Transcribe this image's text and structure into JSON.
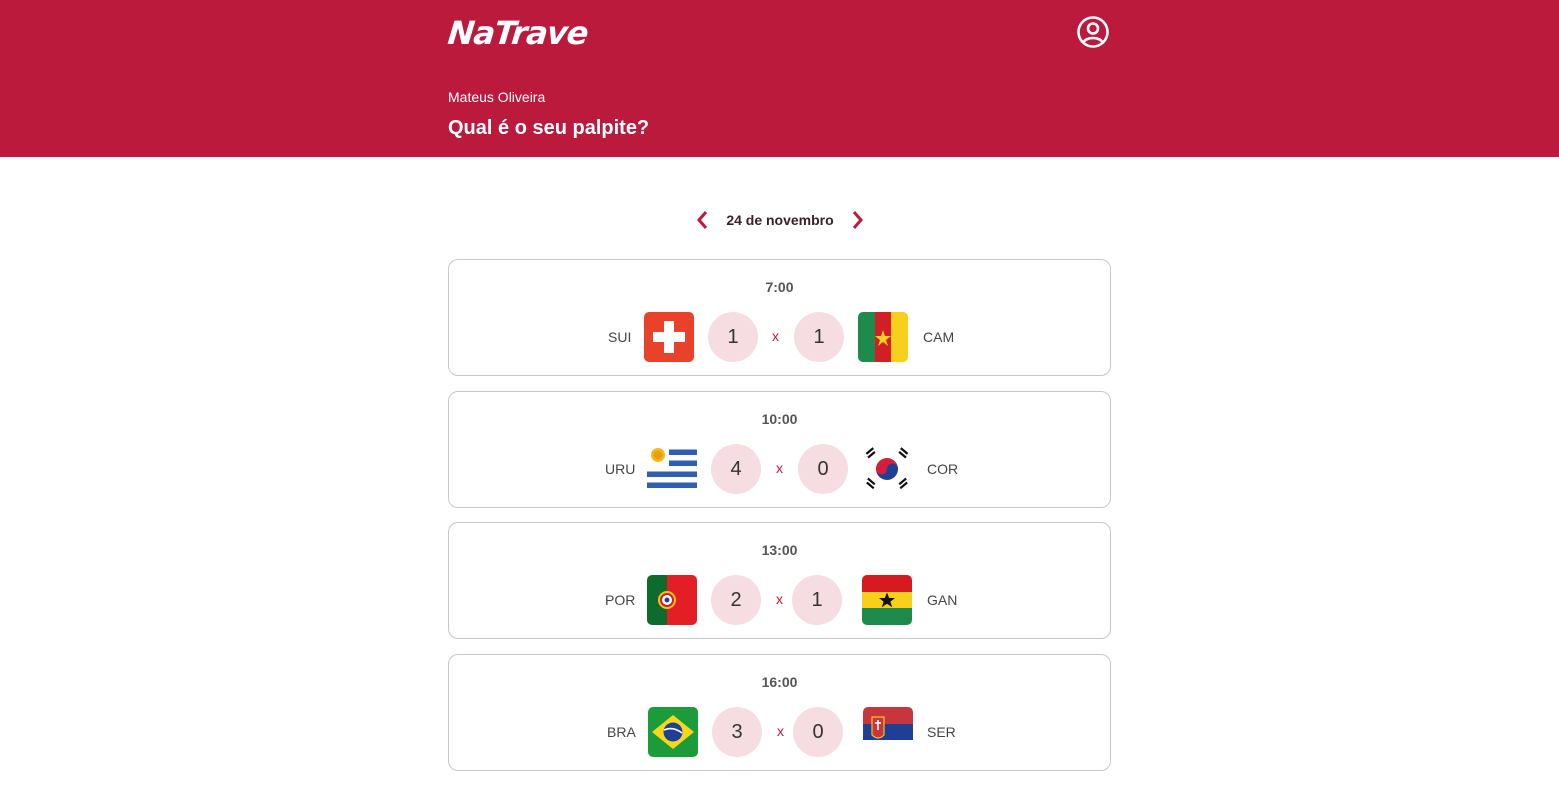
{
  "app": {
    "logo": "NaTrave"
  },
  "header": {
    "user_name": "Mateus Oliveira",
    "headline": "Qual é o seu palpite?"
  },
  "date_nav": {
    "label": "24 de novembro",
    "prev_icon": "chevron-left-icon",
    "next_icon": "chevron-right-icon"
  },
  "colors": {
    "brand": "#BB1A3D",
    "score_bg": "#F6DDE2",
    "card_border": "#C8C8C8"
  },
  "games": [
    {
      "time": "7:00",
      "home": {
        "code": "SUI",
        "flag": "switzerland-flag"
      },
      "home_score": "1",
      "separator": "x",
      "away_score": "1",
      "away": {
        "code": "CAM",
        "flag": "cameroon-flag"
      }
    },
    {
      "time": "10:00",
      "home": {
        "code": "URU",
        "flag": "uruguay-flag"
      },
      "home_score": "4",
      "separator": "x",
      "away_score": "0",
      "away": {
        "code": "COR",
        "flag": "south-korea-flag"
      }
    },
    {
      "time": "13:00",
      "home": {
        "code": "POR",
        "flag": "portugal-flag"
      },
      "home_score": "2",
      "separator": "x",
      "away_score": "1",
      "away": {
        "code": "GAN",
        "flag": "ghana-flag"
      }
    },
    {
      "time": "16:00",
      "home": {
        "code": "BRA",
        "flag": "brazil-flag"
      },
      "home_score": "3",
      "separator": "x",
      "away_score": "0",
      "away": {
        "code": "SER",
        "flag": "serbia-flag"
      }
    }
  ]
}
